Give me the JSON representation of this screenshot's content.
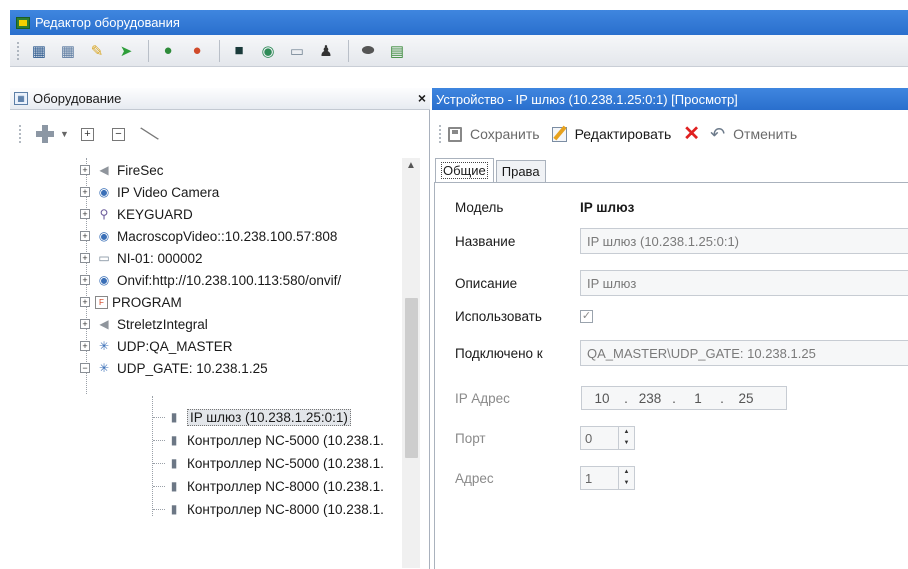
{
  "window": {
    "title": "Редактор оборудования"
  },
  "toolbar": {
    "icons": [
      "tree-view-icon",
      "table-icon",
      "note-icon",
      "plant-icon",
      "user-icon",
      "users-icon",
      "monitor-icon",
      "group-icon",
      "drive-icon",
      "person-icon",
      "pill-icon",
      "card-icon"
    ]
  },
  "left_pane": {
    "title": "Оборудование",
    "close_label": "×"
  },
  "tree": {
    "items": [
      {
        "label": "FireSec",
        "icon": "device-icon"
      },
      {
        "label": "IP Video Camera",
        "icon": "camera-icon"
      },
      {
        "label": "KEYGUARD",
        "icon": "keyguard-icon"
      },
      {
        "label": "MacroscopVideo::10.238.100.57:808",
        "icon": "camera-icon"
      },
      {
        "label": "NI-01: 000002",
        "icon": "drive-icon"
      },
      {
        "label": "Onvif:http://10.238.100.113:580/onvif/",
        "icon": "camera-icon"
      },
      {
        "label": "PROGRAM",
        "icon": "program-icon"
      },
      {
        "label": "StreletzIntegral",
        "icon": "device-icon"
      },
      {
        "label": "UDP:QA_MASTER",
        "icon": "network-icon"
      },
      {
        "label": "UDP_GATE: 10.238.1.25",
        "icon": "network-icon"
      }
    ],
    "children": [
      {
        "label": "IP шлюз (10.238.1.25:0:1)",
        "selected": true
      },
      {
        "label": "Контроллер NC-5000 (10.238.1."
      },
      {
        "label": "Контроллер NC-5000 (10.238.1."
      },
      {
        "label": "Контроллер NC-8000 (10.238.1."
      },
      {
        "label": "Контроллер NC-8000 (10.238.1."
      }
    ]
  },
  "right_pane": {
    "title": "Устройство - IP шлюз (10.238.1.25:0:1) [Просмотр]",
    "toolbar": {
      "save_label": "Сохранить",
      "edit_label": "Редактировать",
      "cancel_label": "Отменить"
    },
    "tabs": [
      "Общие",
      "Права"
    ],
    "form": {
      "model_label": "Модель",
      "model_value": "IP шлюз",
      "name_label": "Название",
      "name_value": "IP шлюз (10.238.1.25:0:1)",
      "description_label": "Описание",
      "description_value": "IP шлюз",
      "use_label": "Использовать",
      "use_checked": true,
      "connected_label": "Подключено к",
      "connected_value": "QA_MASTER\\UDP_GATE: 10.238.1.25",
      "ip_label": "IP Адрес",
      "ip_octets": [
        "10",
        "238",
        "1",
        "25"
      ],
      "port_label": "Порт",
      "port_value": "0",
      "address_label": "Адрес",
      "address_value": "1"
    }
  },
  "colors": {
    "title_blue": "#2a6fcd",
    "cancel_red": "#e02020",
    "edit_orange": "#e7a21e"
  }
}
